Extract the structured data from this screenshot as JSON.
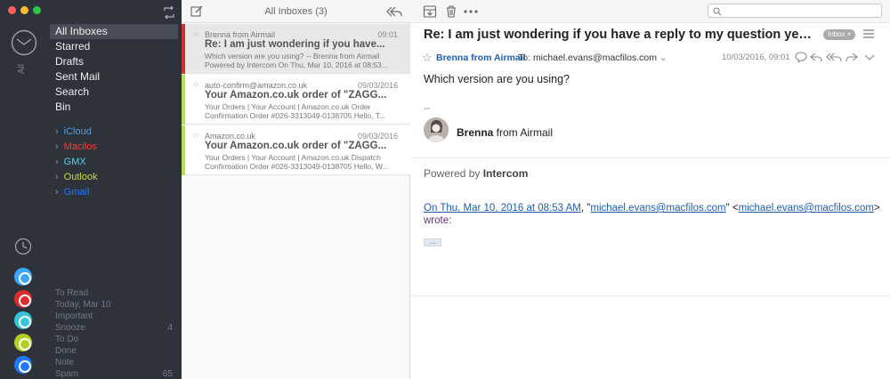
{
  "colors": {
    "sidebar_bg": "#2e323a",
    "accent_blue": "#1e5eb0",
    "unread_red": "#e03a3a",
    "unread_green": "#b7e04a"
  },
  "sidebar": {
    "mailboxes": [
      {
        "label": "All Inboxes",
        "active": true
      },
      {
        "label": "Starred"
      },
      {
        "label": "Drafts"
      },
      {
        "label": "Sent Mail"
      },
      {
        "label": "Search"
      },
      {
        "label": "Bin"
      }
    ],
    "accounts": [
      {
        "label": "iCloud",
        "color": "#3da6ff"
      },
      {
        "label": "Macilos",
        "color": "#ff3b30"
      },
      {
        "label": "GMX",
        "color": "#4cd6e8"
      },
      {
        "label": "Outlook",
        "color": "#c3de30"
      },
      {
        "label": "Gmail",
        "color": "#1e78ff"
      }
    ],
    "smart": [
      {
        "label": "To Read",
        "count": ""
      },
      {
        "label": "Today, Mar 10",
        "count": ""
      },
      {
        "label": "Important",
        "count": ""
      },
      {
        "label": "Snooze",
        "count": "4"
      },
      {
        "label": "To Do",
        "count": ""
      },
      {
        "label": "Done",
        "count": ""
      },
      {
        "label": "Note",
        "count": ""
      },
      {
        "label": "Spam",
        "count": "65"
      }
    ],
    "rail_all_label": "All"
  },
  "list": {
    "title": "All Inboxes (3)",
    "messages": [
      {
        "from": "Brenna from Airmail",
        "date": "09:01",
        "subject": "Re: I am just wondering if you have...",
        "preview": "Which version are you using? -- Brenna from Airmail Powered by Intercom On Thu, Mar 10, 2016 at 08:53...",
        "selected": true,
        "bar": "#d0302f"
      },
      {
        "from": "auto-confirm@amazon.co.uk",
        "date": "09/03/2016",
        "subject": "Your Amazon.co.uk order of \"ZAGG...",
        "preview": "Your Orders | Your Account | Amazon.co.uk Order Confirmation Order #026-3313049-0138705 Hello, T...",
        "bar": "#b7e04a"
      },
      {
        "from": "Amazon.co.uk",
        "date": "09/03/2016",
        "subject": "Your Amazon.co.uk order of \"ZAGG...",
        "preview": "Your Orders | Your Account | Amazon.co.uk Dispatch Confirmation Order #026-3313049-0138705 Hello, W...",
        "bar": "#b7e04a"
      }
    ]
  },
  "reader": {
    "subject": "Re: I am just wondering if you have a reply to my question yesterday...",
    "badge": "Inbox",
    "badge_close": "×",
    "from_name": "Brenna from Airmail",
    "to_label": "To:",
    "to_value": "michael.evans@macfilos.com",
    "date": "10/03/2016, 09:01",
    "body": "Which version are you using?",
    "sig_dash": "--",
    "sig_first": "Brenna",
    "sig_rest": " from Airmail",
    "powered_prefix": "Powered by ",
    "powered_brand": "Intercom",
    "quote_date_link": "On Thu, Mar 10, 2016 at 08:53 AM",
    "quote_sep1": ", \"",
    "quote_email_link1": "michael.evans@macfilos.com",
    "quote_sep2": "\" <",
    "quote_email_link2": "michael.evans@macfilos.com",
    "quote_sep3": ">",
    "quote_wrote": "wrote:",
    "more_label": "...",
    "search_placeholder": ""
  }
}
